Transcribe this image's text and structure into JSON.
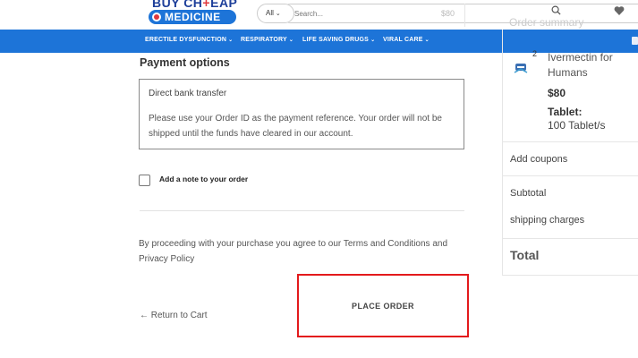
{
  "header": {
    "logo_top": "BUY CH",
    "logo_top_plus": "+",
    "logo_top_end": "EAP",
    "logo_bottom": "MEDICINE",
    "category_select": "All",
    "search_placeholder": "Search...",
    "ghost_price": "$80",
    "ghost_summary": "Order summary"
  },
  "nav": {
    "items": [
      {
        "label": "ERECTILE DYSFUNCTION"
      },
      {
        "label": "RESPIRATORY"
      },
      {
        "label": "LIFE SAVING DRUGS"
      },
      {
        "label": "VIRAL CARE"
      }
    ]
  },
  "checkout": {
    "payment_title": "Payment options",
    "payment_method": "Direct bank transfer",
    "payment_description": "Please use your Order ID as the payment reference. Your order will not be shipped until the funds have cleared in our account.",
    "note_label": "Add a note to your order",
    "terms_text": "By proceeding with your purchase you agree to our Terms and Conditions and Privacy Policy",
    "return_label": "← Return to Cart",
    "place_order_label": "PLACE ORDER"
  },
  "summary": {
    "product": {
      "quantity": "2",
      "name": "Ivermectin for Humans",
      "price": "$80",
      "attribute_name": "Tablet:",
      "attribute_value": "100 Tablet/s"
    },
    "add_coupons": "Add coupons",
    "subtotal_label": "Subtotal",
    "shipping_label": "shipping charges",
    "total_label": "Total"
  },
  "colors": {
    "brand_blue": "#1d74d8",
    "logo_navy": "#1d3f9a",
    "highlight_red": "#e31a1c"
  }
}
